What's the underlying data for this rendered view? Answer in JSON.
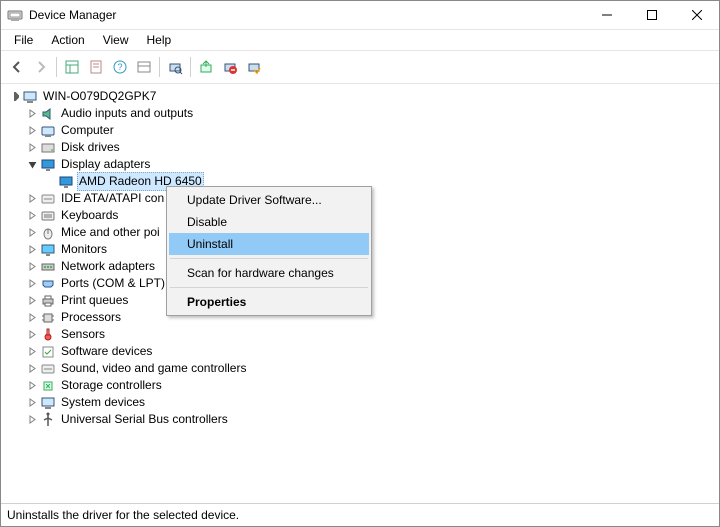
{
  "window": {
    "title": "Device Manager"
  },
  "menubar": {
    "items": [
      "File",
      "Action",
      "View",
      "Help"
    ]
  },
  "tree": {
    "root": "WIN-O079DQ2GPK7",
    "selected_device": "AMD Radeon HD 6450",
    "categories": [
      {
        "label": "Audio inputs and outputs",
        "expanded": false
      },
      {
        "label": "Computer",
        "expanded": false
      },
      {
        "label": "Disk drives",
        "expanded": false
      },
      {
        "label": "Display adapters",
        "expanded": true,
        "children": [
          {
            "label": "AMD Radeon HD 6450"
          }
        ]
      },
      {
        "label": "IDE ATA/ATAPI con",
        "expanded": false,
        "truncated_full": "IDE ATA/ATAPI controllers"
      },
      {
        "label": "Keyboards",
        "expanded": false
      },
      {
        "label": "Mice and other poi",
        "expanded": false,
        "truncated_full": "Mice and other pointing devices"
      },
      {
        "label": "Monitors",
        "expanded": false
      },
      {
        "label": "Network adapters",
        "expanded": false
      },
      {
        "label": "Ports (COM & LPT)",
        "expanded": false
      },
      {
        "label": "Print queues",
        "expanded": false
      },
      {
        "label": "Processors",
        "expanded": false
      },
      {
        "label": "Sensors",
        "expanded": false
      },
      {
        "label": "Software devices",
        "expanded": false
      },
      {
        "label": "Sound, video and game controllers",
        "expanded": false
      },
      {
        "label": "Storage controllers",
        "expanded": false
      },
      {
        "label": "System devices",
        "expanded": false
      },
      {
        "label": "Universal Serial Bus controllers",
        "expanded": false
      }
    ]
  },
  "context_menu": {
    "items": [
      {
        "label": "Update Driver Software...",
        "highlight": false
      },
      {
        "label": "Disable",
        "highlight": false
      },
      {
        "label": "Uninstall",
        "highlight": true
      },
      {
        "sep": true
      },
      {
        "label": "Scan for hardware changes",
        "highlight": false
      },
      {
        "sep": true
      },
      {
        "label": "Properties",
        "highlight": false,
        "bold": true
      }
    ]
  },
  "statusbar": {
    "text": "Uninstalls the driver for the selected device."
  }
}
